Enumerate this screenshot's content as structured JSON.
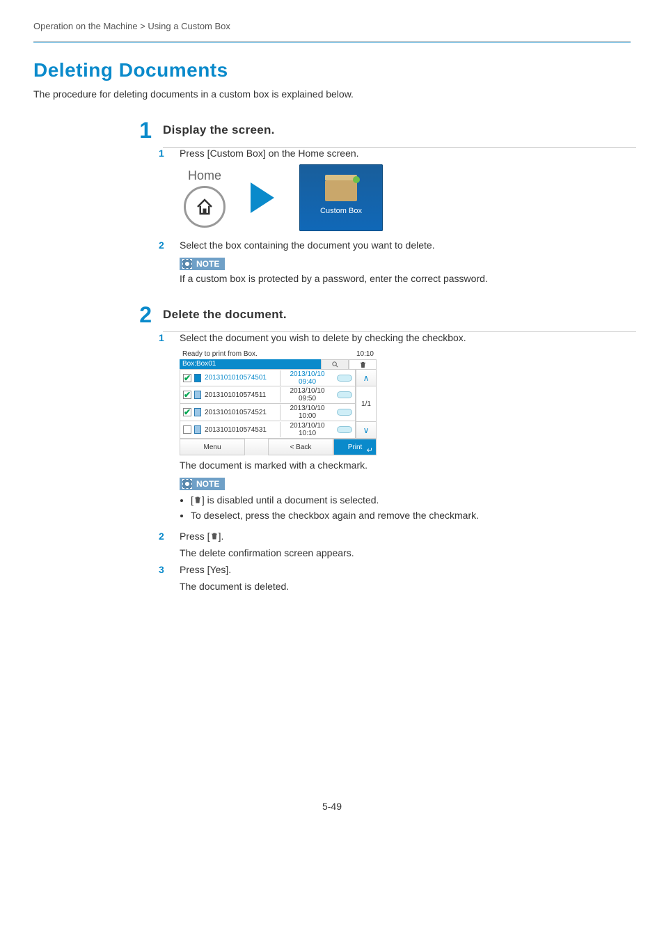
{
  "breadcrumb": "Operation on the Machine > Using a Custom Box",
  "title": "Deleting Documents",
  "intro": "The procedure for deleting documents in a custom box is explained below.",
  "step1": {
    "num": "1",
    "heading": "Display the screen.",
    "sub1": {
      "num": "1",
      "text": "Press [Custom Box] on the Home screen."
    },
    "home_label": "Home",
    "custom_box_label": "Custom Box",
    "sub2": {
      "num": "2",
      "text": "Select the box containing the document you want to delete."
    },
    "note_label": "NOTE",
    "note_body": "If a custom box is protected by a password, enter the correct password."
  },
  "step2": {
    "num": "2",
    "heading": "Delete the document.",
    "sub1": {
      "num": "1",
      "text": "Select the document you wish to delete by checking the checkbox."
    },
    "screen": {
      "status": "Ready to print from Box.",
      "time": "10:10",
      "path": "Box:Box01",
      "rows": [
        {
          "checked": true,
          "sel": true,
          "name": "2013101010574501",
          "date": "2013/10/10 09:40"
        },
        {
          "checked": true,
          "sel": false,
          "name": "2013101010574511",
          "date": "2013/10/10 09:50"
        },
        {
          "checked": true,
          "sel": false,
          "name": "2013101010574521",
          "date": "2013/10/10 10:00"
        },
        {
          "checked": false,
          "sel": false,
          "name": "2013101010574531",
          "date": "2013/10/10 10:10"
        }
      ],
      "page": "1/1",
      "menu": "Menu",
      "back": "< Back",
      "print": "Print"
    },
    "after_screen": "The document is marked with a checkmark.",
    "note_label": "NOTE",
    "note_b1_pre": "[",
    "note_b1_post": "] is disabled until a document is selected.",
    "note_b2": "To deselect, press the checkbox again and remove the checkmark.",
    "sub2": {
      "num": "2",
      "pre": "Press [",
      "post": "]."
    },
    "sub2_after": "The delete confirmation screen appears.",
    "sub3": {
      "num": "3",
      "text": "Press [Yes]."
    },
    "sub3_after": "The document is deleted."
  },
  "footer": "5-49"
}
